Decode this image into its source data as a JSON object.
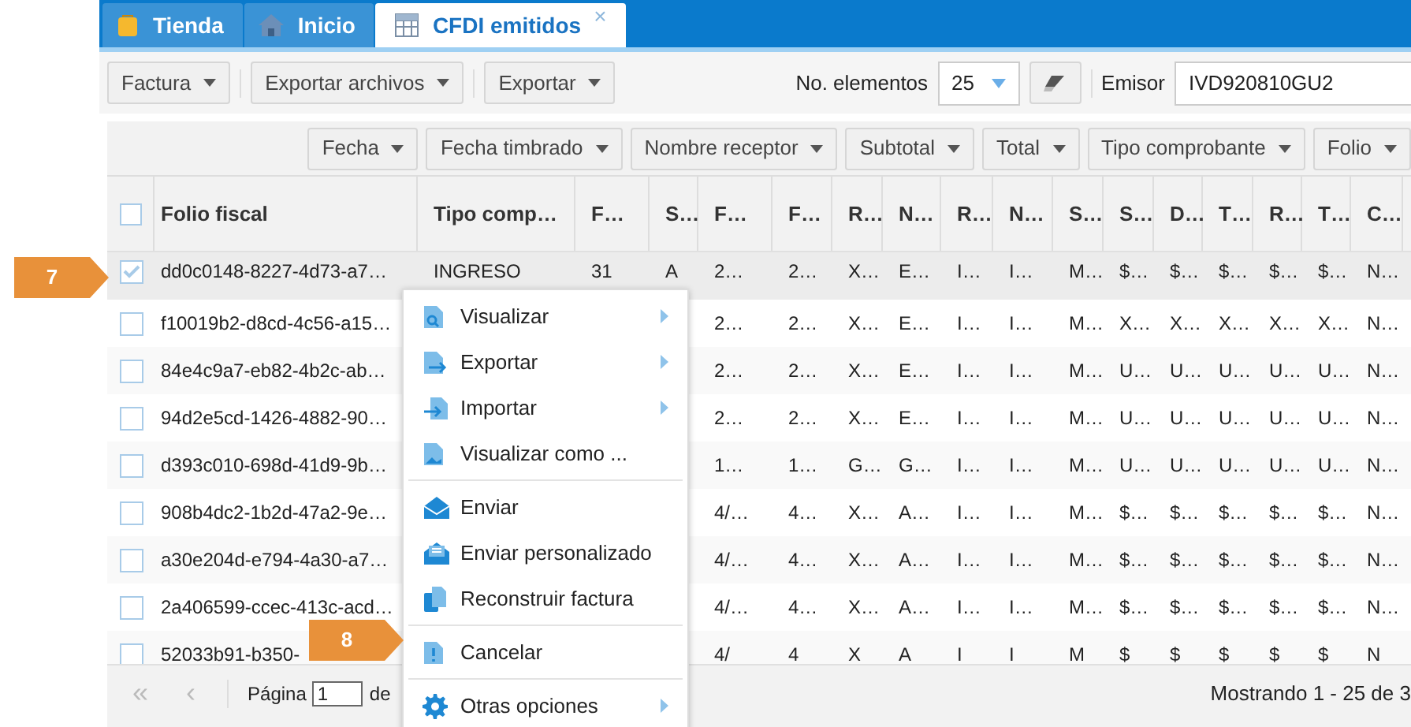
{
  "tabs": [
    {
      "label": "Tienda",
      "kind": "store",
      "selected": false
    },
    {
      "label": "Inicio",
      "kind": "home",
      "selected": false
    },
    {
      "label": "CFDI emitidos",
      "kind": "grid",
      "selected": true,
      "close": "×"
    }
  ],
  "toolbar": {
    "menus": [
      "Factura",
      "Exportar archivos",
      "Exportar"
    ],
    "page_size_label": "No. elementos",
    "page_size": "25",
    "issuer_label": "Emisor",
    "issuer": "IVD920810GU2"
  },
  "filters": [
    "Fecha",
    "Fecha timbrado",
    "Nombre receptor",
    "Subtotal",
    "Total",
    "Tipo comprobante",
    "Folio"
  ],
  "table": {
    "all_checked": false,
    "columns": [
      "Folio fiscal",
      "Tipo comp…",
      "F…",
      "S…",
      "F…",
      "F…",
      "R…",
      "N…",
      "R…",
      "N…",
      "S…",
      "S…",
      "D…",
      "T…",
      "R…",
      "T…",
      "C…"
    ],
    "rows": [
      {
        "selected": true,
        "cells": [
          "dd0c0148-8227-4d73-a7…",
          "INGRESO",
          "31",
          "A",
          "2…",
          "2…",
          "X…",
          "E…",
          "I…",
          "I…",
          "M…",
          "$…",
          "$…",
          "$…",
          "$…",
          "$…",
          "N…"
        ]
      },
      {
        "selected": false,
        "cells": [
          "f10019b2-d8cd-4c56-a15…",
          null,
          null,
          null,
          "2…",
          "2…",
          "X…",
          "E…",
          "I…",
          "I…",
          "M…",
          "X…",
          "X…",
          "X…",
          "X…",
          "X…",
          "N…"
        ]
      },
      {
        "selected": false,
        "cells": [
          "84e4c9a7-eb82-4b2c-ab…",
          null,
          null,
          null,
          "2…",
          "2…",
          "X…",
          "E…",
          "I…",
          "I…",
          "M…",
          "U…",
          "U…",
          "U…",
          "U…",
          "U…",
          "N…"
        ]
      },
      {
        "selected": false,
        "cells": [
          "94d2e5cd-1426-4882-90…",
          null,
          null,
          null,
          "2…",
          "2…",
          "X…",
          "E…",
          "I…",
          "I…",
          "M…",
          "U…",
          "U…",
          "U…",
          "U…",
          "U…",
          "N…"
        ]
      },
      {
        "selected": false,
        "cells": [
          "d393c010-698d-41d9-9b…",
          null,
          null,
          null,
          "1…",
          "1…",
          "G…",
          "G…",
          "I…",
          "I…",
          "M…",
          "U…",
          "U…",
          "U…",
          "U…",
          "U…",
          "N…"
        ]
      },
      {
        "selected": false,
        "cells": [
          "908b4dc2-1b2d-47a2-9e…",
          null,
          null,
          null,
          "4/…",
          "4…",
          "X…",
          "A…",
          "I…",
          "I…",
          "M…",
          "$…",
          "$…",
          "$…",
          "$…",
          "$…",
          "N…"
        ]
      },
      {
        "selected": false,
        "cells": [
          "a30e204d-e794-4a30-a7…",
          null,
          null,
          null,
          "4/…",
          "4…",
          "X…",
          "A…",
          "I…",
          "I…",
          "M…",
          "$…",
          "$…",
          "$…",
          "$…",
          "$…",
          "N…"
        ]
      },
      {
        "selected": false,
        "cells": [
          "2a406599-ccec-413c-acd…",
          null,
          null,
          null,
          "4/…",
          "4…",
          "X…",
          "A…",
          "I…",
          "I…",
          "M…",
          "$…",
          "$…",
          "$…",
          "$…",
          "$…",
          "N…"
        ]
      },
      {
        "selected": false,
        "cells": [
          "52033b91-b350-",
          null,
          null,
          null,
          "4/",
          "4",
          "X",
          "A",
          "I",
          "I",
          "M",
          "$",
          "$",
          "$",
          "$",
          "$",
          "N"
        ]
      }
    ]
  },
  "pager": {
    "first": "«",
    "prev": "‹",
    "page_label": "Página",
    "page": "1",
    "of": "de",
    "summary": "Mostrando 1 - 25 de 3"
  },
  "context_menu": {
    "items": [
      {
        "kind": "item",
        "label": "Visualizar",
        "submenu": true
      },
      {
        "kind": "item",
        "label": "Exportar",
        "submenu": true
      },
      {
        "kind": "item",
        "label": "Importar",
        "submenu": true
      },
      {
        "kind": "item",
        "label": "Visualizar como ...",
        "submenu": false
      },
      {
        "kind": "separator"
      },
      {
        "kind": "item",
        "label": "Enviar",
        "submenu": false
      },
      {
        "kind": "item",
        "label": "Enviar personalizado",
        "submenu": false
      },
      {
        "kind": "item",
        "label": "Reconstruir factura",
        "submenu": false
      },
      {
        "kind": "separator"
      },
      {
        "kind": "item",
        "label": "Cancelar",
        "submenu": false
      },
      {
        "kind": "separator"
      },
      {
        "kind": "item",
        "label": "Otras opciones",
        "submenu": true
      }
    ]
  },
  "annotations": [
    {
      "label": "7"
    },
    {
      "label": "8"
    }
  ]
}
